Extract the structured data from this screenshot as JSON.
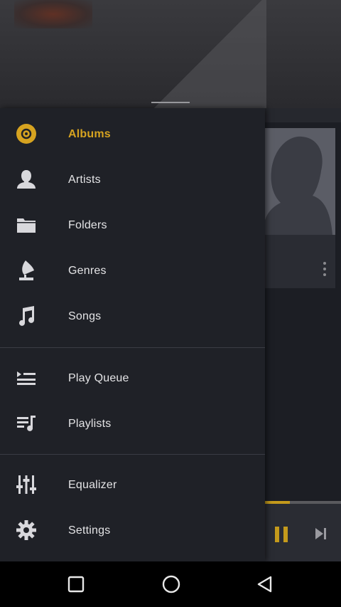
{
  "drawer": {
    "items": [
      {
        "label": "Albums",
        "icon": "album-disc-icon",
        "active": true
      },
      {
        "label": "Artists",
        "icon": "artist-person-icon"
      },
      {
        "label": "Folders",
        "icon": "folder-icon"
      },
      {
        "label": "Genres",
        "icon": "gramophone-icon"
      },
      {
        "label": "Songs",
        "icon": "music-note-icon"
      },
      {
        "label": "Play Queue",
        "icon": "play-queue-icon"
      },
      {
        "label": "Playlists",
        "icon": "playlist-icon"
      },
      {
        "label": "Equalizer",
        "icon": "equalizer-icon"
      },
      {
        "label": "Settings",
        "icon": "gear-icon"
      }
    ]
  },
  "background_player": {
    "progress": 0.85,
    "controls": [
      "pause-icon",
      "skip-next-icon"
    ]
  },
  "nav": {
    "buttons": [
      "recent-apps-icon",
      "home-icon",
      "back-icon"
    ]
  },
  "colors": {
    "accent": "#d6a320",
    "drawer_bg": "#1f2127",
    "text": "#e4e4e6"
  }
}
